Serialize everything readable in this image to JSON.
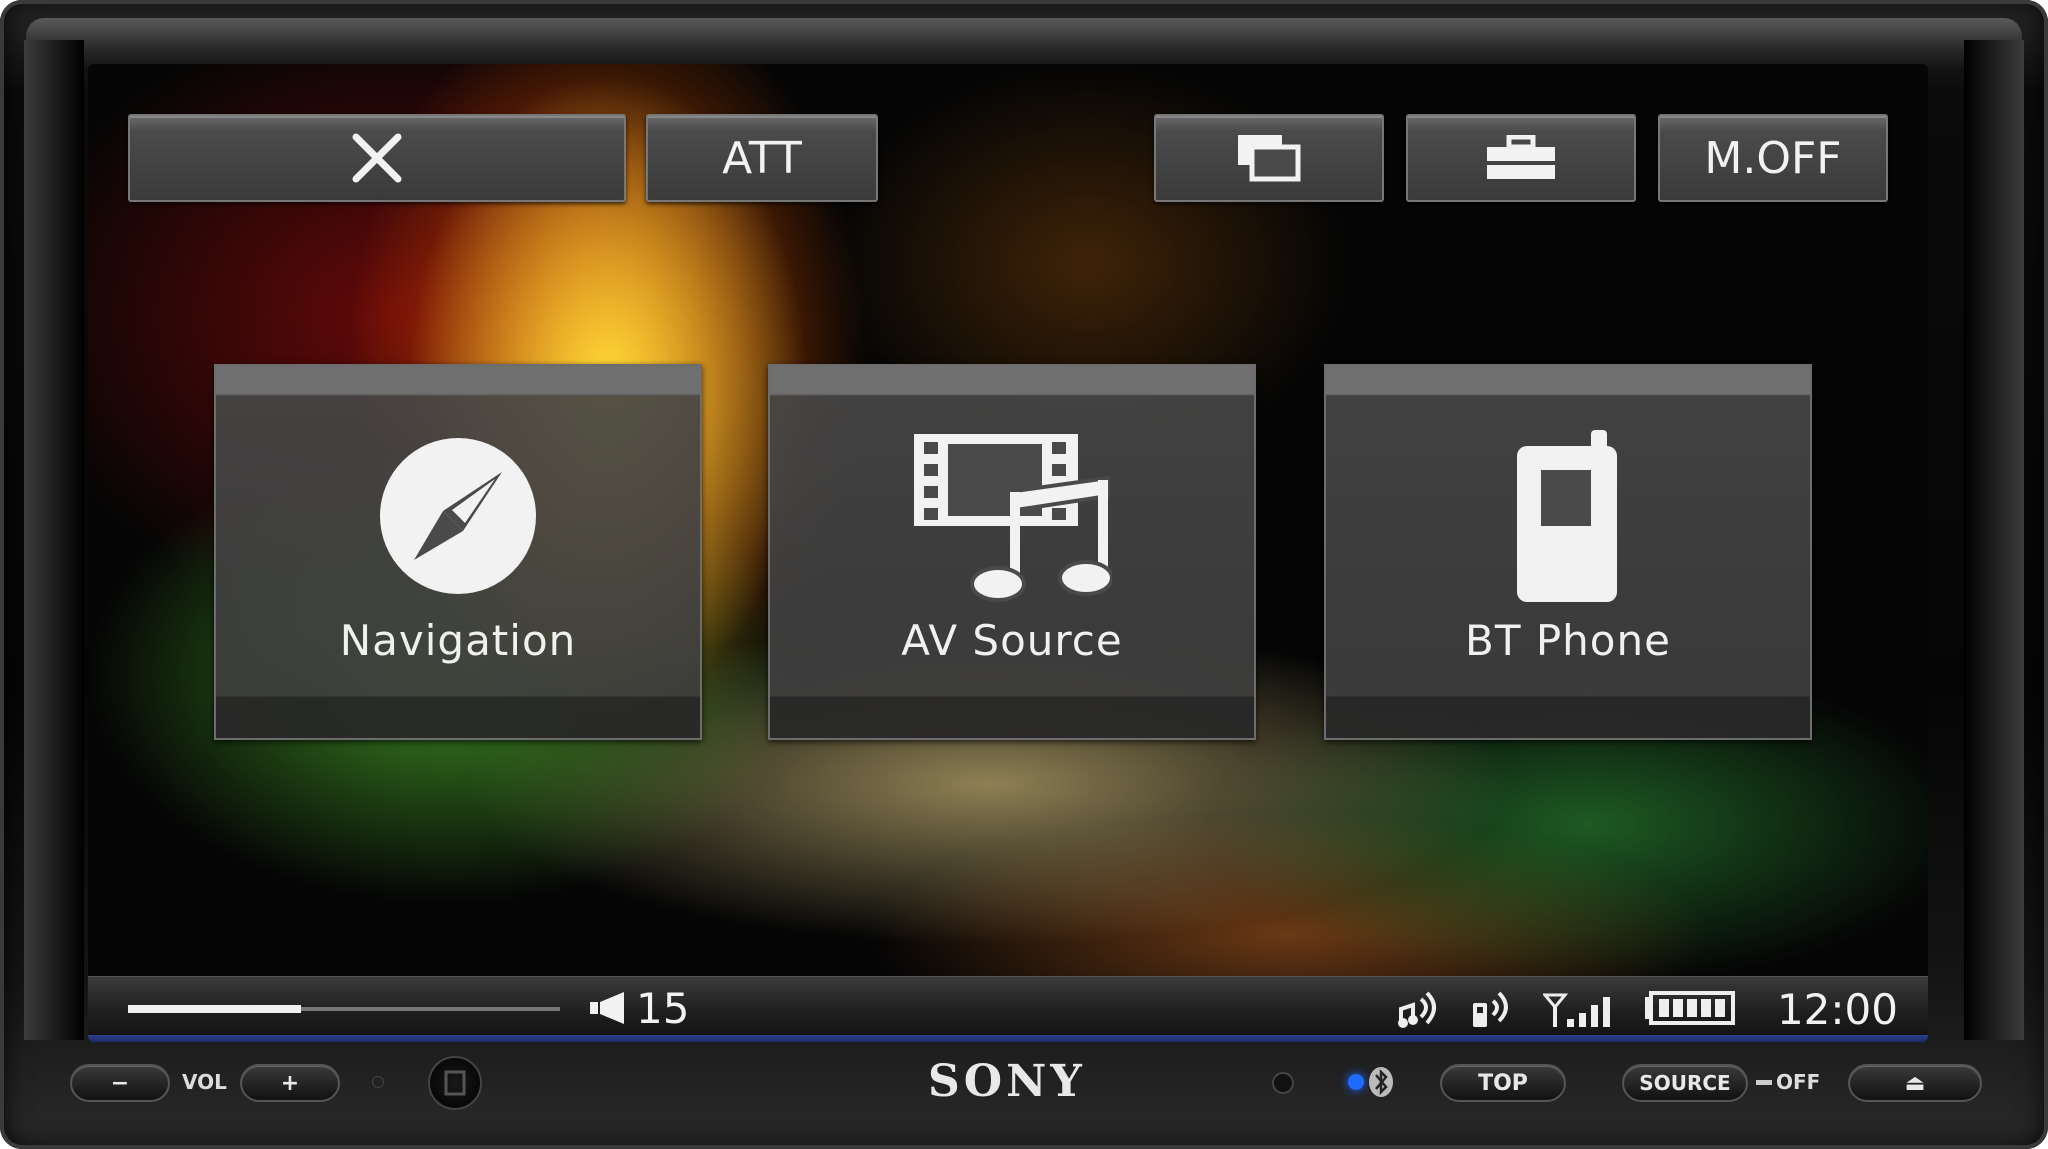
{
  "top_bar": {
    "close_icon": "close-icon",
    "att_label": "ATT",
    "screen_icon": "display-switch-icon",
    "settings_icon": "toolbox-icon",
    "moff_label": "M.OFF"
  },
  "tiles": [
    {
      "label": "Navigation",
      "icon": "compass-icon"
    },
    {
      "label": "AV Source",
      "icon": "film-music-icon"
    },
    {
      "label": "BT Phone",
      "icon": "mobile-phone-icon"
    }
  ],
  "status": {
    "progress": 0.4,
    "volume": "15",
    "clock": "12:00",
    "icons": [
      "bt-audio-icon",
      "bt-phone-icon",
      "signal-icon",
      "battery-icon"
    ]
  },
  "hardware": {
    "minus_label": "−",
    "vol_label": "VOL",
    "plus_label": "+",
    "brand": "SONY",
    "top_label": "TOP",
    "source_label": "SOURCE",
    "off_label": "OFF",
    "eject_label": "⏏"
  },
  "colors": {
    "accent_blue": "#2b3f8c",
    "button_grey": "#4b4b4b"
  }
}
